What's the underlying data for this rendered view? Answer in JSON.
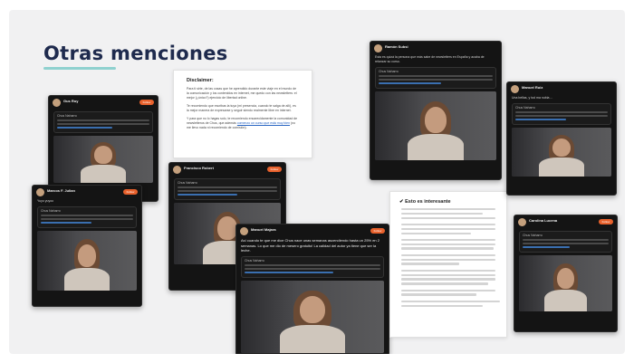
{
  "page": {
    "title": "Otras menciones",
    "colors": {
      "title": "#1e2a4d",
      "underline": "#8fd1cf",
      "card_bg": "#141414",
      "follow": "#e8612c"
    }
  },
  "disclaimer": {
    "heading": "Disclaimer:",
    "p1": "Para ti sirte, de las cosas que he aprendido durante este viaje en el mundo de la comunicación y los contenidos en internet, me quedo con las newsletters: el mejor (¿único?) ejercicio de libertad online.",
    "p2": "Te recomiendo que escribas la tuya (mi presencia, cuando te salga de allí), es la mejor manera de expresarse y seguir siendo realmente libre en internet.",
    "p3_before": "Y para que no lo hagas solo, te recomiendo encarecidamente la comunidad de newsletteros de Chus, que además",
    "p3_link": "comenzo un curso que está muy bien",
    "p3_after": "(no me llevo nada ni recomiendo de comisión)."
  },
  "article": {
    "heading": "✔ Esto es interesante"
  },
  "cards": [
    {
      "id": "c1",
      "name": "Gus Roy",
      "quote_name": "Chus Naharro",
      "follow": "Follow"
    },
    {
      "id": "c2",
      "name": "Marcos F. Julian",
      "text": "Yuyo yuyoo",
      "quote_name": "Chus Naharro",
      "follow": "Follow"
    },
    {
      "id": "c3",
      "name": "Francisco Robert",
      "quote_name": "Chus Naharro",
      "follow": "Follow"
    },
    {
      "id": "c4",
      "name": "Manuel Majara",
      "text": "Así cuando te que me dice Chus nace unas semanas ascendiendo hasta un 25% en 2 semanas. Lo que me dio de mesero gratuito! La calidad del autor ya tiene que ser la leche.",
      "quote_name": "Chus Naharro",
      "follow": "Follow"
    },
    {
      "id": "c5",
      "name": "Ramón Subsi",
      "text": "Esta es quizá la persona que más sabe de newsletters en España y acaba de relanzar su curso.",
      "quote_name": "Chus Naharro",
      "follow": "Follow"
    },
    {
      "id": "c6",
      "name": "Manuel Ruiz",
      "text": "Una bellas, y tod ma nubia ...",
      "quote_name": "Chus Naharro",
      "follow": "Follow"
    },
    {
      "id": "c7",
      "name": "Carolina Lucena",
      "quote_name": "Chus Naharro",
      "follow": "Follow"
    }
  ]
}
